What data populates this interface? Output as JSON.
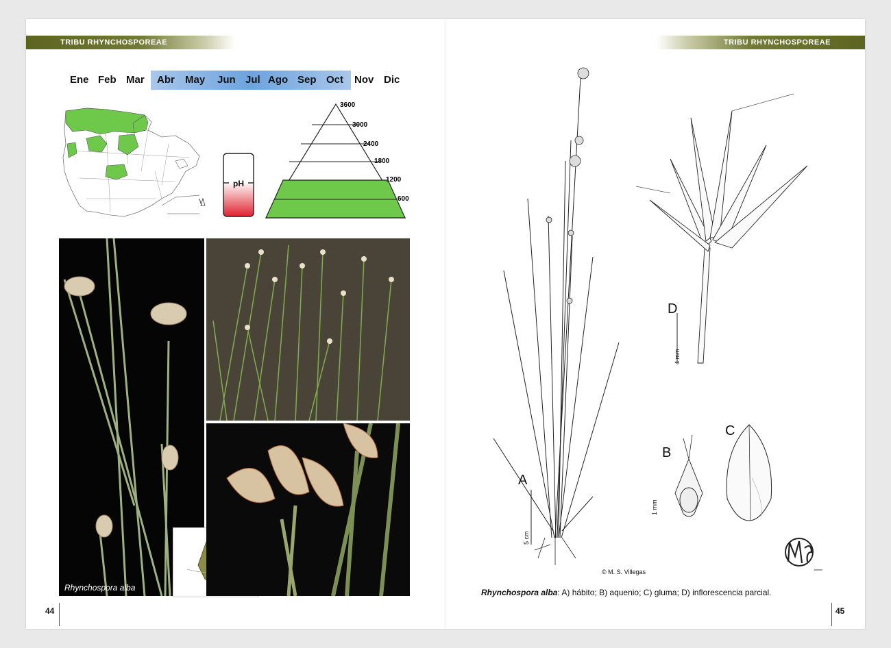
{
  "header": {
    "left_title": "TRIBU RHYNCHOSPOREAE",
    "right_title": "TRIBU RHYNCHOSPOREAE"
  },
  "months": [
    "Ene",
    "Feb",
    "Mar",
    "Abr",
    "May",
    "Jun",
    "Jul",
    "Ago",
    "Sep",
    "Oct",
    "Nov",
    "Dic"
  ],
  "flowering_months": [
    "Abr",
    "May",
    "Jun",
    "Jul",
    "Ago",
    "Sep",
    "Oct"
  ],
  "ph": {
    "label": "pH"
  },
  "altitude": {
    "levels": [
      "3600",
      "3000",
      "2400",
      "1800",
      "1200",
      "600"
    ],
    "occupied_bands": 2
  },
  "photo_caption": "Rhynchospora alba",
  "illustration": {
    "labels": {
      "a": "A",
      "b": "B",
      "c": "C",
      "d": "D"
    },
    "scales": {
      "a": "5 cm",
      "b": "1 mm",
      "d": "4 mm"
    },
    "copyright": "© M. S. Villegas"
  },
  "caption": {
    "species": "Rhynchospora alba",
    "text": ": A) hábito; B) aquenio; C) gluma; D) inflorescencia parcial."
  },
  "pages": {
    "left": "44",
    "right": "45"
  },
  "colors": {
    "header": "#5c6420",
    "range_green": "#6ec84a",
    "month_highlight": "#6da3de",
    "ph_red": "#e0202e"
  }
}
